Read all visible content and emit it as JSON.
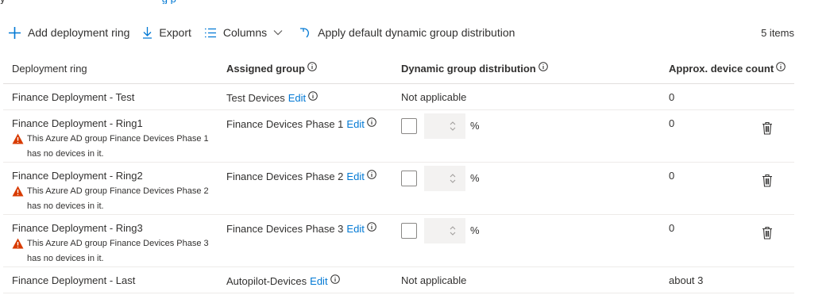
{
  "top_fragment": {
    "text": "y",
    "link": "g p"
  },
  "toolbar": {
    "add_label": "Add deployment ring",
    "export_label": "Export",
    "columns_label": "Columns",
    "apply_label": "Apply default dynamic group distribution",
    "count_label": "5 items"
  },
  "table": {
    "headers": {
      "ring": "Deployment ring",
      "group": "Assigned group",
      "distribution": "Dynamic group distribution",
      "count": "Approx. device count"
    },
    "edit_label": "Edit",
    "pct_label": "%",
    "rows": [
      {
        "ring": "Finance Deployment - Test",
        "group": "Test Devices",
        "distribution": "Not applicable",
        "count": "0"
      },
      {
        "ring": "Finance Deployment - Ring1",
        "warning": "This Azure AD group Finance Devices Phase 1 has no devices in it.",
        "group": "Finance Devices Phase 1",
        "count": "0"
      },
      {
        "ring": "Finance Deployment - Ring2",
        "warning": "This Azure AD group Finance Devices Phase 2 has no devices in it.",
        "group": "Finance Devices Phase 2",
        "count": "0"
      },
      {
        "ring": "Finance Deployment - Ring3",
        "warning": "This Azure AD group Finance Devices Phase 3 has no devices in it.",
        "group": "Finance Devices Phase 3",
        "count": "0"
      },
      {
        "ring": "Finance Deployment - Last",
        "group": "Autopilot-Devices",
        "distribution": "Not applicable",
        "count": "about 3"
      }
    ]
  },
  "colors": {
    "accent": "#0078d4",
    "warning": "#d83b01",
    "text": "#323130"
  },
  "icons": {
    "add": "plus-icon",
    "export": "download-icon",
    "columns": "list-icon",
    "apply": "undo-icon",
    "info": "info-icon",
    "delete": "trash-icon",
    "warning": "warning-icon"
  }
}
